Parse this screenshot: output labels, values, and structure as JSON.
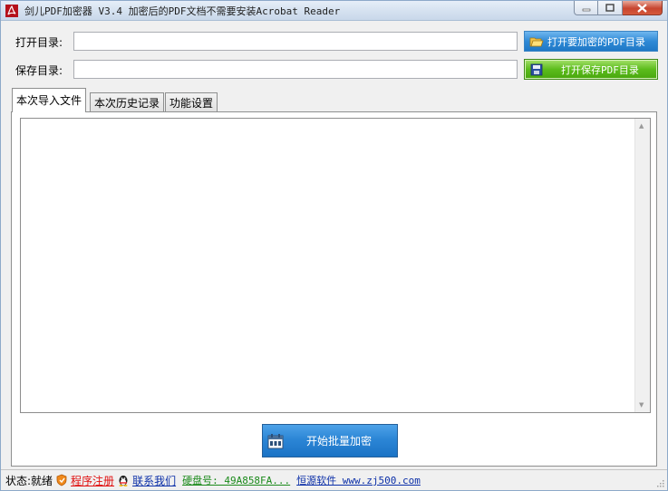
{
  "window": {
    "title": "剑儿PDF加密器  V3.4 加密后的PDF文档不需要安装Acrobat Reader",
    "accent": "#2c86d6"
  },
  "paths": {
    "open_label": "打开目录:",
    "open_value": "",
    "open_button": "打开要加密的PDF目录",
    "save_label": "保存目录:",
    "save_value": "",
    "save_button": "打开保存PDF目录"
  },
  "tabs": [
    {
      "label": "本次导入文件",
      "active": true
    },
    {
      "label": "本次历史记录",
      "active": false
    },
    {
      "label": "功能设置",
      "active": false
    }
  ],
  "actions": {
    "start_label": "开始批量加密"
  },
  "status": {
    "state_text": "状态:就绪",
    "register_link": "程序注册",
    "contact_link": "联系我们",
    "disk_id": "硬盘号: 49A858FA...",
    "vendor": "恒源软件 www.zj500.com"
  }
}
